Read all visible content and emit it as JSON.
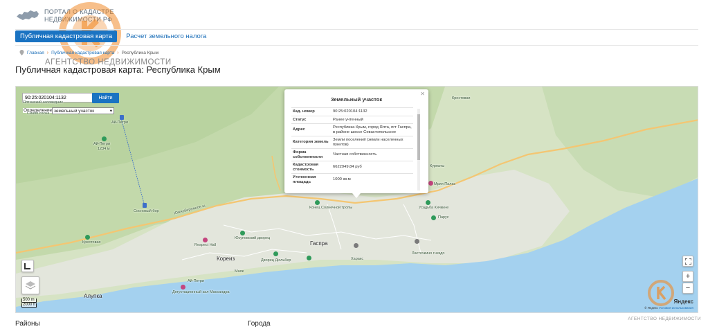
{
  "header": {
    "portal_title": "ПОРТАЛ О КАДАСТРЕ НЕДВИЖИМОСТИ РФ",
    "agency_watermark": "АГЕНТСТВО НЕДВИЖИМОСТИ"
  },
  "nav": {
    "tabs": [
      {
        "label": "Публичная кадастровая карта",
        "active": true
      },
      {
        "label": "Расчет земельного налога",
        "active": false
      }
    ]
  },
  "breadcrumb": {
    "items": [
      "Главная",
      "Публичная кадастровая карта",
      "Республика Крым"
    ]
  },
  "page": {
    "title": "Публичная кадастровая карта: Республика Крым"
  },
  "map": {
    "search_value": "90:25:020104:1132",
    "find_label": "Найти",
    "definition_label": "Определение",
    "definition_value": "земельный участок",
    "scale": {
      "m": "500 m",
      "ft": "2000 ft"
    },
    "copyright": "© Яндекс",
    "copyright_link": "Условия использования",
    "yandex_logo": "Яндекс",
    "labels": {
      "ai_petri_mountain": "Ай-Петри",
      "ai_petri_height": "1234 м",
      "ai_petri_station": "Ай-Петри",
      "sosnovy_bor": "Сосновый бор",
      "south_shore": "Южнобережное ш",
      "krestovaya": "Крестовая",
      "krestovaya_right": "Крестовая",
      "gaspra": "Гаспра",
      "koreiz": "Кореиз",
      "alupka": "Алупка",
      "yusupov_palace": "Юсуповский дворец",
      "dyulber_palace": "Дворец Дюльбер",
      "kharaks": "Харакс",
      "swallow_nest": "Ласточкино гнездо",
      "resort_hall": "Respect Hall",
      "end_trail": "Конец Солнечной тропы",
      "tasting": "Дегустационный зал Массандра",
      "ai_petri_bottom": "Ай-Петри",
      "mayak": "Маяк",
      "parus": "Парус",
      "kurpaty": "Курпаты",
      "usadba": "Усадьба Кичкине",
      "yaltinskiy": "Ялтинский заповедник",
      "mriya": "Мрия Палас",
      "sinyaya": "Синяя сосна"
    }
  },
  "popup": {
    "title": "Земельный участок",
    "rows": [
      {
        "key": "Кад. номер",
        "value": "90:25:020104:1132"
      },
      {
        "key": "Статус",
        "value": "Ранее учтенный"
      },
      {
        "key": "Адрес",
        "value": "Республика Крым, город Ялта, пгт Гаспра, в районе шоссе Севастопольское"
      },
      {
        "key": "Категория земель",
        "value": "Земли поселений (земли населенных пунктов)"
      },
      {
        "key": "Форма собственности",
        "value": "Частная собственность"
      },
      {
        "key": "Кадастровая стоимость",
        "value": "6622949.84 руб"
      },
      {
        "key": "Уточненная площадь",
        "value": "1000 кв.м"
      }
    ]
  },
  "bottom": {
    "districts": "Районы",
    "cities": "Города",
    "agency_footer": "АГЕНТСТВО НЕДВИЖИМОСТИ"
  },
  "colors": {
    "accent": "#1a73c2",
    "sea": "#a4d1ef",
    "forest": "#c9dfb3",
    "logo_orange": "#f08a2a"
  }
}
